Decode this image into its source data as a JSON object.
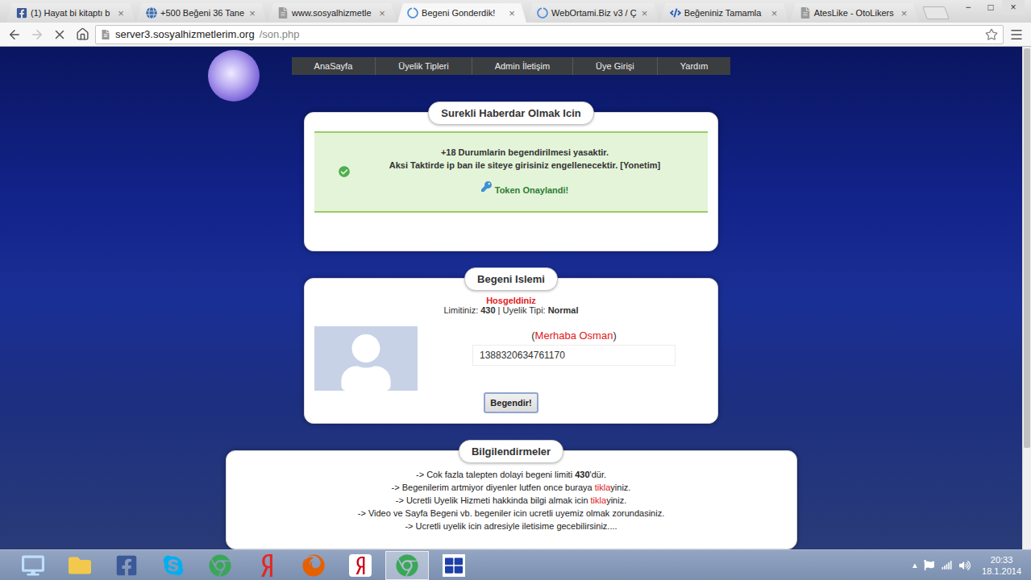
{
  "browser": {
    "tabs": [
      {
        "title": "(1) Hayat bi kitaptı b",
        "kind": "facebook",
        "selected": false
      },
      {
        "title": "+500 Beğeni 36 Tane",
        "kind": "globe",
        "selected": false
      },
      {
        "title": "www.sosyalhizmetle",
        "kind": "page",
        "selected": false
      },
      {
        "title": "Begeni Gonderdik!",
        "kind": "loading",
        "selected": true
      },
      {
        "title": "WebOrtami.Biz v3 / Ç",
        "kind": "loading",
        "selected": false
      },
      {
        "title": "Beğeniniz Tamamla",
        "kind": "code",
        "selected": false
      },
      {
        "title": "AtesLike - OtoLikers",
        "kind": "page",
        "selected": false
      }
    ],
    "tab_close": "×",
    "window_controls": [
      "−",
      "□",
      "×"
    ],
    "back_disabled": false,
    "forward_disabled": true,
    "loading": true,
    "url_host": "server3.sosyalhizmetlerim.org",
    "url_path": "/son.php",
    "bookmarked": false,
    "scrollbar_level": 0.8
  },
  "site": {
    "nav": [
      "AnaSayfa",
      "Üyelik Tipleri",
      "Admin İletişim",
      "Üye Girişi",
      "Yardım"
    ],
    "notice": {
      "title": "Surekli Haberdar Olmak Icin",
      "lines": [
        "+18 Durumlarin begendirilmesi yasaktir.",
        "Aksi Taktirde ip ban ile siteye girisiniz engellenecektir. [Yonetim]"
      ],
      "token": "Token Onaylandi!"
    },
    "like": {
      "title": "Begeni Islemi",
      "welcome": "Hosgeldiniz",
      "limit_label": "Limitiniz:",
      "limit": "430",
      "separator": "|",
      "type_label": "Uyelik Tipi:",
      "type": "Normal",
      "open": "(",
      "greeting": "Merhaba Osman",
      "close": ")",
      "token_value": "1388320634761170",
      "button": "Begendir!"
    },
    "info": {
      "title": "Bilgilendirmeler",
      "lines": [
        {
          "parts": [
            {
              "text": "-> Cok fazla talepten dolayi begeni limiti ",
              "style": "plain"
            },
            {
              "text": "430",
              "style": "bold"
            },
            {
              "text": "'dür.",
              "style": "plain"
            }
          ]
        },
        {
          "parts": [
            {
              "text": "-> Begenilerim artmiyor diyenler lutfen once buraya ",
              "style": "plain"
            },
            {
              "text": "tikla",
              "style": "link"
            },
            {
              "text": "yiniz.",
              "style": "plain"
            }
          ]
        },
        {
          "parts": [
            {
              "text": "-> Ucretli Uyelik Hizmeti hakkinda bilgi almak icin ",
              "style": "plain"
            },
            {
              "text": "tikla",
              "style": "link"
            },
            {
              "text": "yiniz.",
              "style": "plain"
            }
          ]
        },
        {
          "parts": [
            {
              "text": "-> Video ve Sayfa Begeni vb. begeniler icin ucretli uyemiz olmak zorundasiniz.",
              "style": "plain"
            }
          ]
        },
        {
          "parts": [
            {
              "text": "-> Ucretli uyelik icin adresiyle iletisime gecebilirsiniz....",
              "style": "plain"
            }
          ]
        }
      ]
    }
  },
  "taskbar": {
    "apps": [
      {
        "kind": "desktop",
        "selected": false
      },
      {
        "kind": "folder",
        "selected": false
      },
      {
        "kind": "facebook",
        "selected": false
      },
      {
        "kind": "skype",
        "selected": false
      },
      {
        "kind": "chrome",
        "selected": false
      },
      {
        "kind": "yandex",
        "selected": false
      },
      {
        "kind": "firefox",
        "selected": false
      },
      {
        "kind": "yandex-browser",
        "selected": false
      },
      {
        "kind": "chrome",
        "selected": true
      },
      {
        "kind": "app",
        "selected": false
      }
    ],
    "tray_arrow": "▴",
    "clock": "20:33",
    "date": "18.1.2014"
  }
}
